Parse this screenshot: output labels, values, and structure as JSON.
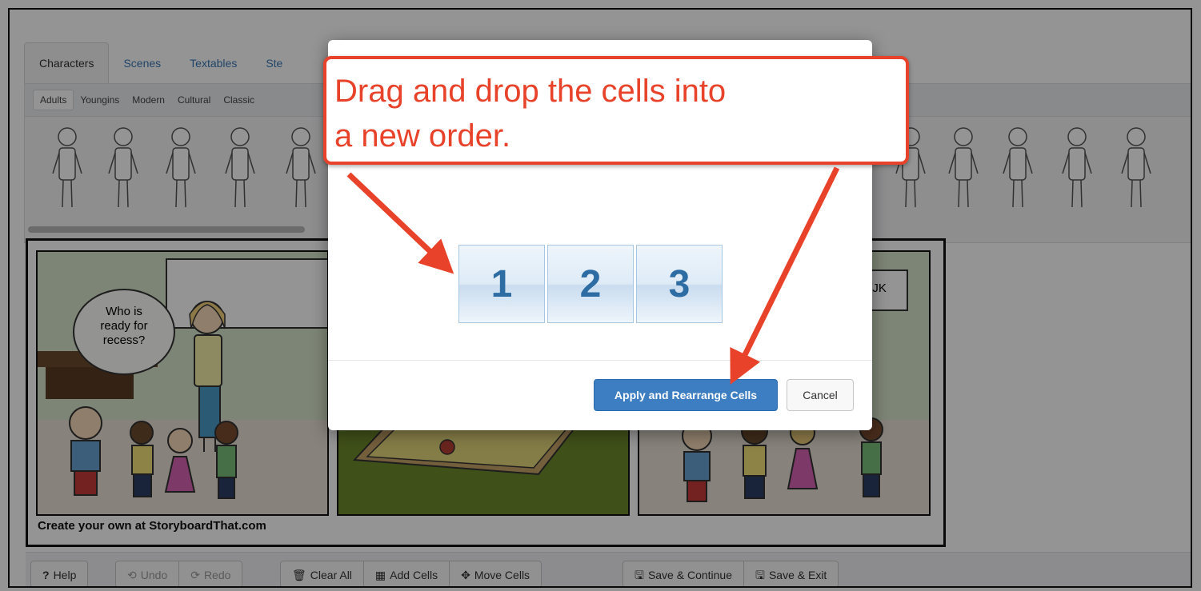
{
  "library": {
    "tabs": [
      "Characters",
      "Scenes",
      "Textables",
      "Ste"
    ],
    "subtabs": [
      "Adults",
      "Youngins",
      "Modern",
      "Cultural",
      "Classic"
    ]
  },
  "storyboard": {
    "speech_lines": [
      "Who is",
      "ready for",
      "recess?"
    ],
    "sign_text": "IJK",
    "watermark": "Create your own at StoryboardThat.com"
  },
  "modal": {
    "cells": [
      "1",
      "2",
      "3"
    ],
    "apply_label": "Apply and Rearrange Cells",
    "cancel_label": "Cancel"
  },
  "callout": {
    "line1": "Drag and drop the cells into",
    "line2": "a new order.",
    "color": "#e8432a"
  },
  "toolbar": {
    "help": "Help",
    "undo": "Undo",
    "redo": "Redo",
    "clear_all": "Clear All",
    "add_cells": "Add Cells",
    "move_cells": "Move Cells",
    "save_continue": "Save & Continue",
    "save_exit": "Save & Exit"
  }
}
